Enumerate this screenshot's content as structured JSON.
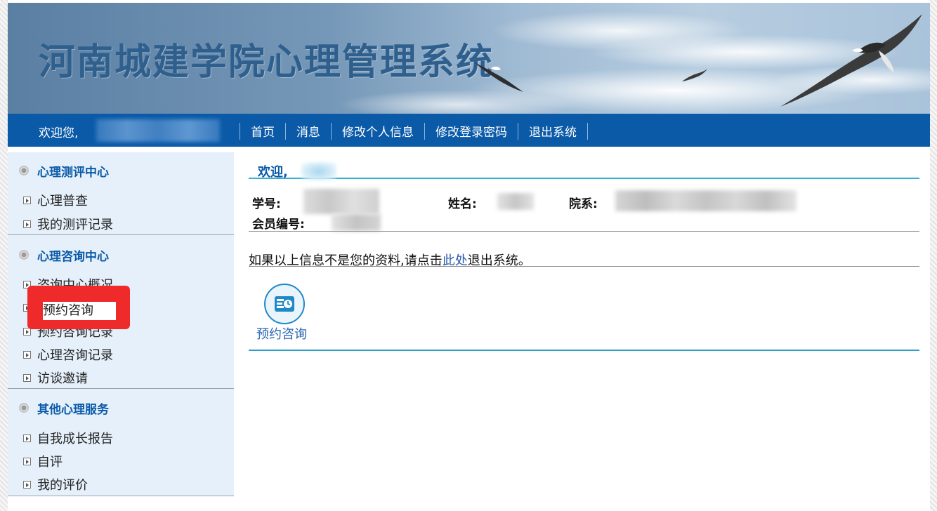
{
  "header": {
    "title": "河南城建学院心理管理系统"
  },
  "navbar": {
    "welcome_label": "欢迎您,",
    "items": [
      {
        "label": "首页"
      },
      {
        "label": "消息"
      },
      {
        "label": "修改个人信息"
      },
      {
        "label": "修改登录密码"
      },
      {
        "label": "退出系统"
      }
    ]
  },
  "sidebar": {
    "sections": [
      {
        "title": "心理测评中心",
        "items": [
          {
            "label": "心理普查"
          },
          {
            "label": "我的测评记录"
          }
        ]
      },
      {
        "title": "心理咨询中心",
        "items": [
          {
            "label": "咨询中心概况"
          },
          {
            "label": "预约咨询"
          },
          {
            "label": "预约咨询记录"
          },
          {
            "label": "心理咨询记录"
          },
          {
            "label": "访谈邀请"
          }
        ]
      },
      {
        "title": "其他心理服务",
        "items": [
          {
            "label": "自我成长报告"
          },
          {
            "label": "自评"
          },
          {
            "label": "我的评价"
          }
        ]
      }
    ]
  },
  "main": {
    "welcome": "欢迎,",
    "fields": {
      "student_id_label": "学号:",
      "name_label": "姓名:",
      "department_label": "院系:",
      "member_id_label": "会员编号:"
    },
    "notice": {
      "before": "如果以上信息不是您的资料,请点击",
      "link": "此处",
      "after": "退出系统。"
    },
    "quick_action": {
      "label": "预约咨询",
      "icon": "appointment-icon"
    }
  },
  "colors": {
    "nav_bg": "#0a5aa8",
    "sidebar_bg": "#e6f0fa",
    "accent": "#3aaed2",
    "highlight": "#ef2a2a"
  }
}
